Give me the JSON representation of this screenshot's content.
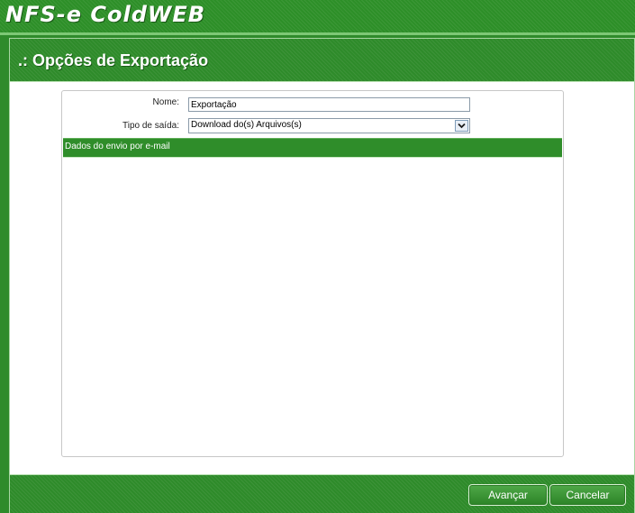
{
  "app": {
    "title": "NFS-e ColdWEB"
  },
  "panel": {
    "title": ".: Opções de Exportação"
  },
  "form": {
    "name_label": "Nome:",
    "name_value": "Exportação",
    "output_type_label": "Tipo de saída:",
    "output_type_value": "Download do(s) Arquivos(s)",
    "email_section_title": "Dados do envio por e-mail"
  },
  "footer": {
    "advance_label": "Avançar",
    "cancel_label": "Cancelar"
  },
  "icons": {
    "select_arrow": "chevron-down-icon"
  },
  "colors": {
    "brand_green": "#2e8b2a",
    "panel_background": "#ffffff"
  }
}
